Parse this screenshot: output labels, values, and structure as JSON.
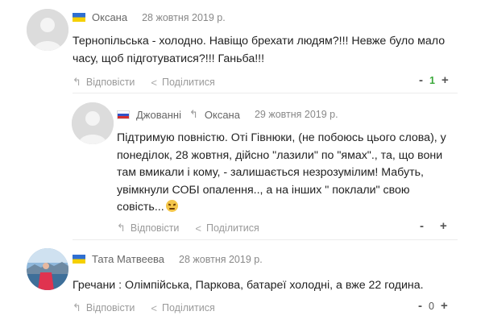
{
  "comments": [
    {
      "author": "Оксана",
      "date": "28 жовтня 2019 р.",
      "text": "Тернопільська - холодно. Навіщо брехати людям?!!! Невже було мало часу, щоб підготуватися?!!! Ганьба!!!",
      "reply_label": "Відповісти",
      "share_label": "Поділитися",
      "score": "1",
      "minus": "-",
      "plus": "+"
    },
    {
      "author": "Джованні",
      "reply_to": "Оксана",
      "date": "29 жовтня 2019 р.",
      "text": "Підтримую повністю. Оті Гівнюки, (не побоюсь цього слова), у понеділок, 28 жовтня, дійсно \"лазили\" по \"ямах\"., та, що вони там вмикали і кому, - залишається незрозумілим! Мабуть, увімкнули СОБІ опалення.., а на інших \" поклали\" свою совість...",
      "reply_label": "Відповісти",
      "share_label": "Поділитися",
      "minus": "-",
      "plus": "+"
    },
    {
      "author": "Тата Матвеева",
      "date": "28 жовтня 2019 р.",
      "text": "Гречани : Олімпійська, Паркова,  батареї  холодні, а вже 22 година.",
      "reply_label": "Відповісти",
      "share_label": "Поділитися",
      "score": "0",
      "minus": "-",
      "plus": "+"
    }
  ],
  "icons": {
    "reply": "reply-icon",
    "share": "share-icon",
    "reply_to": "reply-arrow-icon",
    "emoji": "angry-face-emoji"
  },
  "colors": {
    "positive_score": "#3aa83a",
    "meta_text": "#888888"
  }
}
